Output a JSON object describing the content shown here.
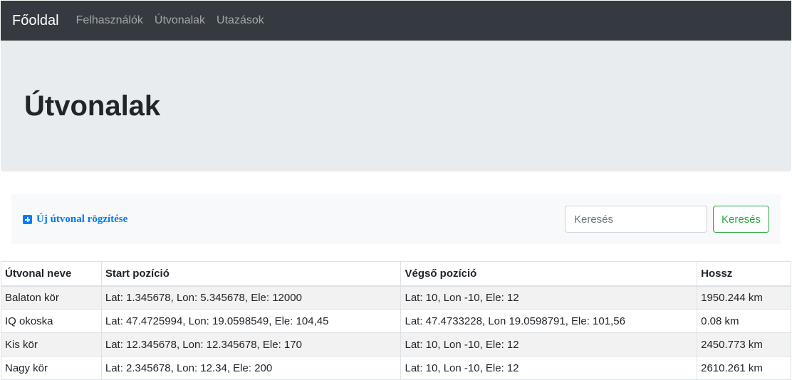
{
  "navbar": {
    "brand": "Főoldal",
    "links": [
      "Felhasználók",
      "Útvonalak",
      "Utazások"
    ]
  },
  "page": {
    "title": "Útvonalak"
  },
  "toolbar": {
    "new_route_label": "Új útvonal rögzítése",
    "search_placeholder": "Keresés",
    "search_button_label": "Keresés"
  },
  "table": {
    "headers": [
      "Útvonal neve",
      "Start pozíció",
      "Végső pozíció",
      "Hossz"
    ],
    "rows": [
      [
        "Balaton kör",
        "Lat: 1.345678, Lon: 5.345678, Ele: 12000",
        "Lat: 10, Lon -10, Ele: 12",
        "1950.244 km"
      ],
      [
        "IQ okoska",
        "Lat: 47.4725994, Lon: 19.0598549, Ele: 104,45",
        "Lat: 47.4733228, Lon 19.0598791, Ele: 101,56",
        "0.08 km"
      ],
      [
        "Kis kör",
        "Lat: 12.345678, Lon: 12.345678, Ele: 170",
        "Lat: 10, Lon -10, Ele: 12",
        "2450.773 km"
      ],
      [
        "Nagy kör",
        "Lat: 2.345678, Lon: 12.34, Ele: 200",
        "Lat: 10, Lon -10, Ele: 12",
        "2610.261 km"
      ]
    ]
  },
  "colors": {
    "navbar_bg": "#343a40",
    "jumbotron_bg": "#e9ecef",
    "link_blue": "#007bff",
    "success_green": "#28a745"
  },
  "icons": {
    "new_route": "plus-square-icon"
  }
}
